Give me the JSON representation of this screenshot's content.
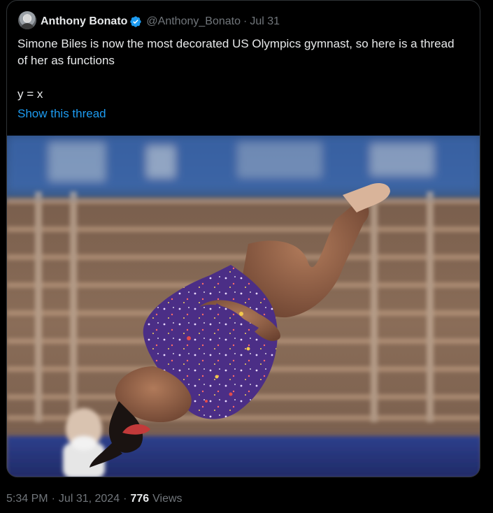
{
  "tweet": {
    "author": {
      "display_name": "Anthony Bonato",
      "handle": "@Anthony_Bonato",
      "verified": true,
      "avatar_icon": "avatar-photo"
    },
    "date": "Jul 31",
    "separator": "·",
    "text": "Simone Biles is now the most decorated US Olympics gymnast, so here is a thread of her as functions\n\ny = x",
    "show_thread_label": "Show this thread",
    "media": {
      "description_icon": "gymnast-photo"
    }
  },
  "footer": {
    "time": "5:34 PM",
    "date": "Jul 31, 2024",
    "separator": "·",
    "views_count": "776",
    "views_label": "Views"
  },
  "colors": {
    "background": "#000000",
    "text_primary": "#e7e9ea",
    "text_secondary": "#71767b",
    "link": "#1d9bf0",
    "verified": "#1d9bf0",
    "border": "#2f3336"
  }
}
